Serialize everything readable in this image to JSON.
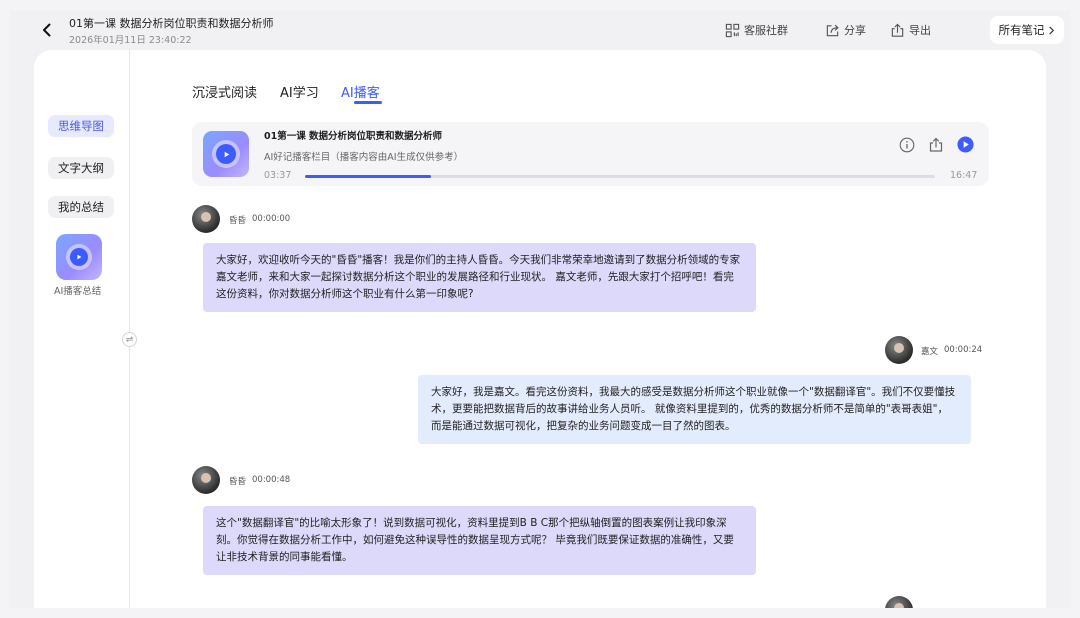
{
  "header": {
    "title": "01第一课 数据分析岗位职责和数据分析师",
    "date": "2026年01月11日 23:40:22",
    "community_label": "客服社群",
    "share_label": "分享",
    "export_label": "导出",
    "all_notes_label": "所有笔记"
  },
  "sidebar": {
    "items": [
      {
        "label": "思维导图",
        "active": true
      },
      {
        "label": "文字大纲",
        "active": false
      },
      {
        "label": "我的总结",
        "active": false
      }
    ],
    "podcast_caption": "AI播客总结"
  },
  "tabs": [
    {
      "label": "沉浸式阅读",
      "active": false
    },
    {
      "label": "AI学习",
      "active": false
    },
    {
      "label": "AI播客",
      "active": true
    }
  ],
  "player": {
    "title": "01第一课 数据分析岗位职责和数据分析师",
    "subtitle": "AI好记播客栏目（播客内容由AI生成仅供参考）",
    "current_time": "03:37",
    "total_time": "16:47",
    "progress": 0.2
  },
  "messages": [
    {
      "speaker": "昏昏",
      "time": "00:00:00",
      "side": "left",
      "text": "大家好，欢迎收听今天的\"昏昏\"播客！我是你们的主持人昏昏。今天我们非常荣幸地邀请到了数据分析领域的专家嘉文老师，来和大家一起探讨数据分析这个职业的发展路径和行业现状。 嘉文老师，先跟大家打个招呼吧！看完这份资料，你对数据分析师这个职业有什么第一印象呢?"
    },
    {
      "speaker": "嘉文",
      "time": "00:00:24",
      "side": "right",
      "text": "大家好，我是嘉文。看完这份资料，我最大的感受是数据分析师这个职业就像一个\"数据翻译官\"。我们不仅要懂技术，更要能把数据背后的故事讲给业务人员听。 就像资料里提到的，优秀的数据分析师不是简单的\"表哥表姐\"，而是能通过数据可视化，把复杂的业务问题变成一目了然的图表。"
    },
    {
      "speaker": "昏昏",
      "time": "00:00:48",
      "side": "left",
      "text": "这个\"数据翻译官\"的比喻太形象了！说到数据可视化，资料里提到B B C那个把纵轴倒置的图表案例让我印象深刻。你觉得在数据分析工作中，如何避免这种误导性的数据呈现方式呢？ 毕竟我们既要保证数据的准确性，又要让非技术背景的同事能看懂。"
    }
  ]
}
